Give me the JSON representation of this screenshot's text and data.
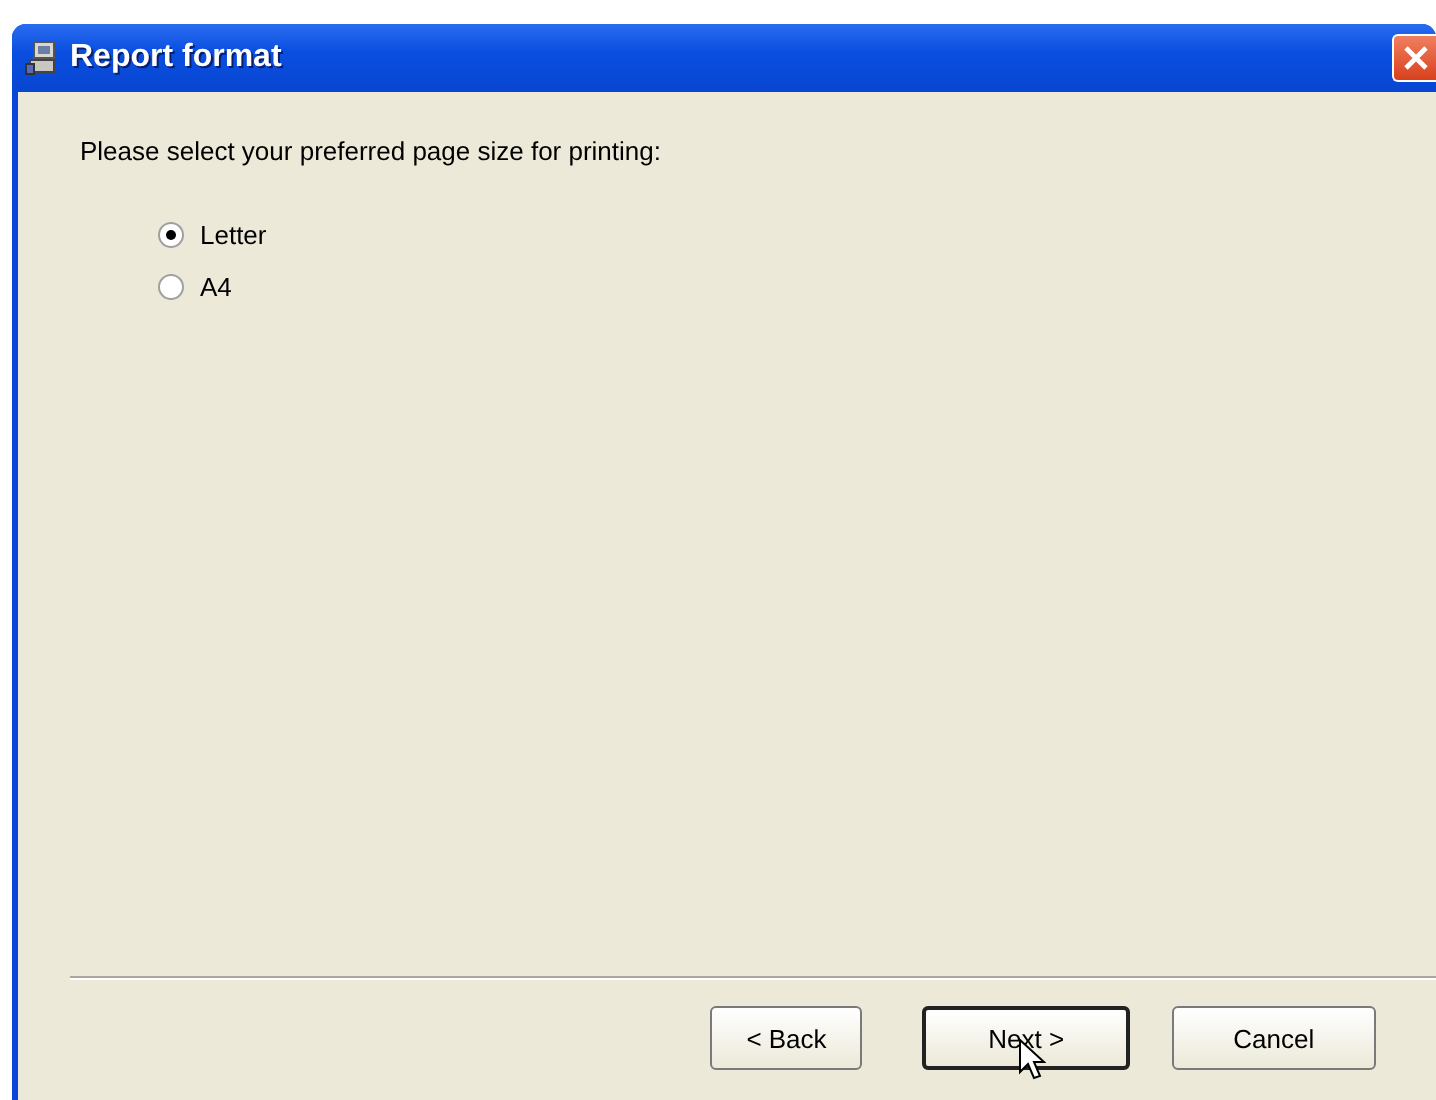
{
  "window": {
    "title": "Report format"
  },
  "prompt": "Please select your preferred page size for printing:",
  "options": [
    {
      "label": "Letter",
      "selected": true
    },
    {
      "label": "A4",
      "selected": false
    }
  ],
  "buttons": [
    {
      "label": "< Back",
      "default": false
    },
    {
      "label": "Next >",
      "default": true
    },
    {
      "label": "Cancel",
      "default": false
    }
  ]
}
